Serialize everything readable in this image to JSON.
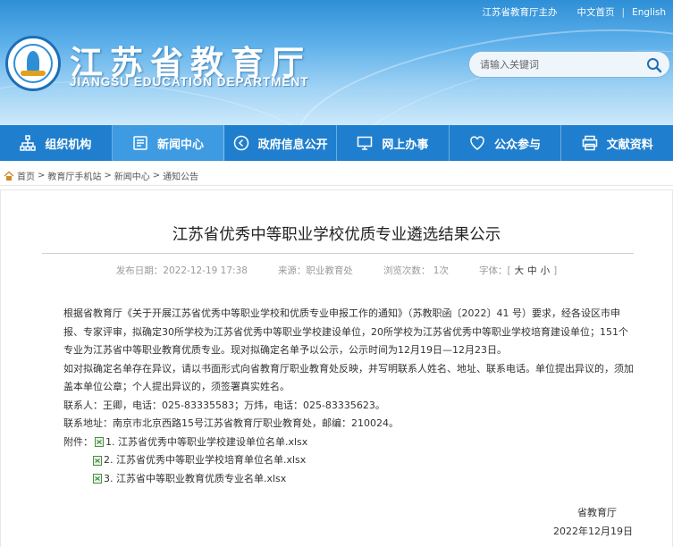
{
  "toplinks": {
    "sponsor": "江苏省教育厅主办",
    "home": "中文首页",
    "sep": "|",
    "english": "English"
  },
  "site": {
    "title": "江苏省教育厅",
    "subtitle": "JIANGSU EDUCATION DEPARTMENT"
  },
  "search": {
    "placeholder": "请输入关键词"
  },
  "nav": [
    {
      "label": "组织机构",
      "icon": "org-chart-icon"
    },
    {
      "label": "新闻中心",
      "icon": "news-icon"
    },
    {
      "label": "政府信息公开",
      "icon": "info-icon"
    },
    {
      "label": "网上办事",
      "icon": "monitor-icon"
    },
    {
      "label": "公众参与",
      "icon": "heart-icon"
    },
    {
      "label": "文献资料",
      "icon": "printer-icon"
    }
  ],
  "breadcrumb": [
    "首页",
    ">",
    "教育厅手机站",
    ">",
    "新闻中心",
    ">",
    "通知公告"
  ],
  "article": {
    "title": "江苏省优秀中等职业学校优质专业遴选结果公示",
    "publish_date": "发布日期：2022-12-19 17:38",
    "source": "来源：职业教育处",
    "views": "浏览次数： 1次",
    "font_label": "字体：[",
    "font_large": "大",
    "font_medium": "中",
    "font_small": "小",
    "font_end": "]",
    "para1": "根据省教育厅《关于开展江苏省优秀中等职业学校和优质专业申报工作的通知》（苏教职函〔2022〕41 号）要求，经各设区市申报、专家评审，拟确定30所学校为江苏省优秀中等职业学校建设单位，20所学校为江苏省优秀中等职业学校培育建设单位；151个专业为江苏省中等职业教育优质专业。现对拟确定名单予以公示，公示时间为12月19日—12月23日。",
    "para2": "如对拟确定名单存在异议，请以书面形式向省教育厅职业教育处反映，并写明联系人姓名、地址、联系电话。单位提出异议的，须加盖本单位公章；个人提出异议的，须签署真实姓名。",
    "contact": "联系人：王卿，电话：025-83335583；万炜，电话：025-83335623。",
    "address": "联系地址：南京市北京西路15号江苏省教育厅职业教育处，邮编：210024。",
    "attach_label": "附件：",
    "attachments": [
      "1. 江苏省优秀中等职业学校建设单位名单.xlsx",
      "2. 江苏省优秀中等职业学校培育单位名单.xlsx",
      "3. 江苏省中等职业教育优质专业名单.xlsx"
    ],
    "signature": "省教育厅",
    "sign_date": "2022年12月19日"
  }
}
